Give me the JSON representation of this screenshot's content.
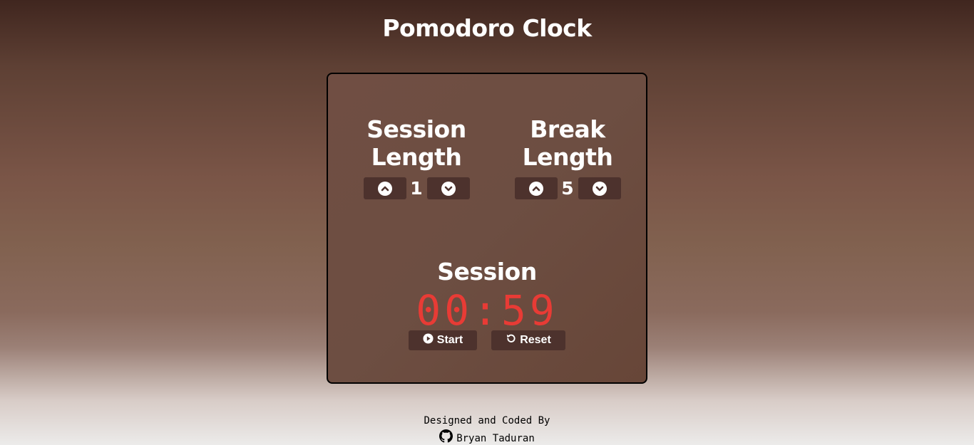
{
  "app": {
    "title": "Pomodoro Clock"
  },
  "session_length": {
    "label": "Session Length",
    "value": "1",
    "increment_icon": "chevron-up-circle-icon",
    "decrement_icon": "chevron-down-circle-icon"
  },
  "break_length": {
    "label": "Break Length",
    "value": "5",
    "increment_icon": "chevron-up-circle-icon",
    "decrement_icon": "chevron-down-circle-icon"
  },
  "timer": {
    "label": "Session",
    "display": "00:59",
    "color": "#e83b35"
  },
  "controls": {
    "start_label": "Start",
    "start_icon": "play-circle-icon",
    "reset_label": "Reset",
    "reset_icon": "undo-icon"
  },
  "footer": {
    "line1": "Designed and Coded By",
    "author": "Bryan Taduran",
    "author_icon": "github-icon"
  }
}
